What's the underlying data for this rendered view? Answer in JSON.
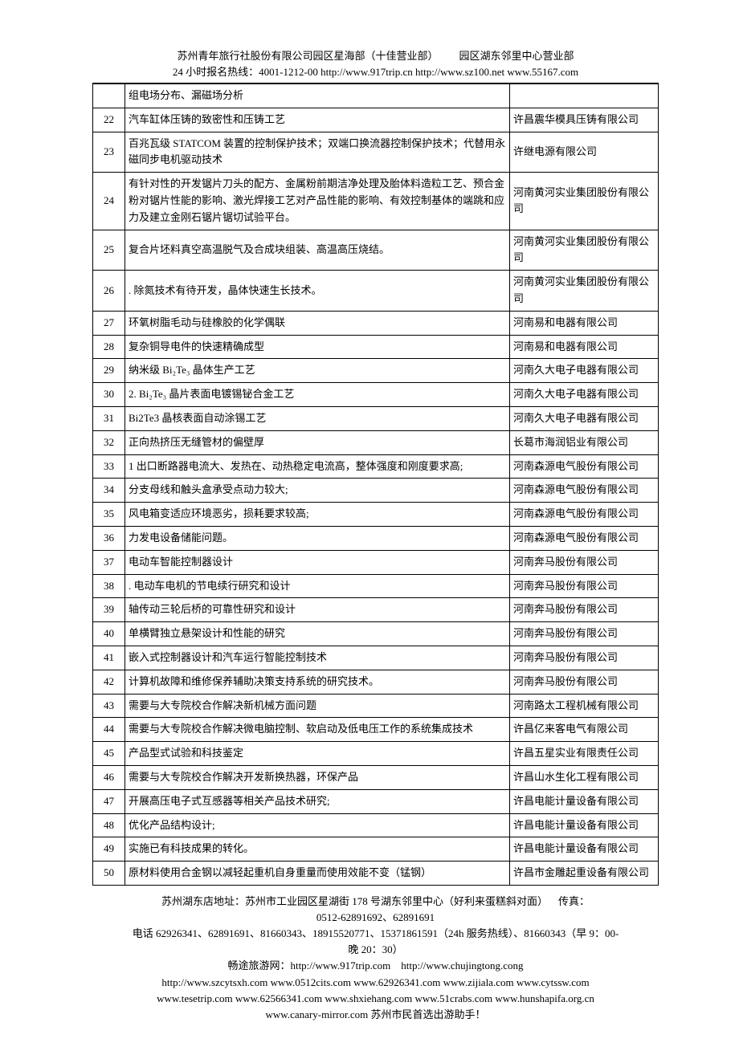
{
  "header": {
    "line1": "苏州青年旅行社股份有限公司园区星海部（十佳营业部）  园区湖东邻里中心营业部",
    "line2": "24 小时报名热线：4001-1212-00 http://www.917trip.cn http://www.sz100.net www.55167.com"
  },
  "rows": [
    {
      "n": "",
      "d": "组电场分布、漏磁场分析",
      "c": ""
    },
    {
      "n": "22",
      "d": "汽车缸体压铸的致密性和压铸工艺",
      "c": "许昌震华模具压铸有限公司"
    },
    {
      "n": "23",
      "d": "百兆瓦级 STATCOM 装置的控制保护技术；双端口换流器控制保护技术；代替用永磁同步电机驱动技术",
      "c": "许继电源有限公司"
    },
    {
      "n": "24",
      "d": "有针对性的开发锯片刀头的配方、金属粉前期洁净处理及胎体料造粒工艺、预合金粉对锯片性能的影响、激光焊接工艺对产品性能的影响、有效控制基体的端跳和应力及建立金刚石锯片锯切试验平台。",
      "c": "河南黄河实业集团股份有限公司"
    },
    {
      "n": "25",
      "d": "复合片坯料真空高温脱气及合成块组装、高温高压烧结。",
      "c": "河南黄河实业集团股份有限公司"
    },
    {
      "n": "26",
      "d": ". 除氮技术有待开发，晶体快速生长技术。",
      "c": "河南黄河实业集团股份有限公司"
    },
    {
      "n": "27",
      "d": "环氧树脂毛动与硅橡胶的化学偶联",
      "c": "河南易和电器有限公司"
    },
    {
      "n": "28",
      "d": "复杂铜导电件的快速精确成型",
      "c": "河南易和电器有限公司"
    },
    {
      "n": "29",
      "d": "纳米级 Bi₂Te₃ 晶体生产工艺",
      "c": "河南久大电子电器有限公司"
    },
    {
      "n": "30",
      "d": "2. Bi₂Te₃ 晶片表面电镀锡铋合金工艺",
      "c": "河南久大电子电器有限公司"
    },
    {
      "n": "31",
      "d": "Bi2Te3 晶核表面自动涂锡工艺",
      "c": "河南久大电子电器有限公司"
    },
    {
      "n": "32",
      "d": "正向热挤压无缝管材的偏壁厚",
      "c": "长葛市海润铝业有限公司"
    },
    {
      "n": "33",
      "d": "1 出口断路器电流大、发热在、动热稳定电流高，整体强度和刚度要求高;",
      "c": "河南森源电气股份有限公司"
    },
    {
      "n": "34",
      "d": "分支母线和触头盒承受点动力较大;",
      "c": "河南森源电气股份有限公司"
    },
    {
      "n": "35",
      "d": "风电箱变适应环境恶劣，损耗要求较高;",
      "c": "河南森源电气股份有限公司"
    },
    {
      "n": "36",
      "d": "力发电设备储能问题。",
      "c": "河南森源电气股份有限公司"
    },
    {
      "n": "37",
      "d": "电动车智能控制器设计",
      "c": "河南奔马股份有限公司"
    },
    {
      "n": "38",
      "d": ". 电动车电机的节电续行研究和设计",
      "c": "河南奔马股份有限公司"
    },
    {
      "n": "39",
      "d": "轴传动三轮后桥的可靠性研究和设计",
      "c": "河南奔马股份有限公司"
    },
    {
      "n": "40",
      "d": "单横臂独立悬架设计和性能的研究",
      "c": "河南奔马股份有限公司"
    },
    {
      "n": "41",
      "d": "嵌入式控制器设计和汽车运行智能控制技术",
      "c": "河南奔马股份有限公司"
    },
    {
      "n": "42",
      "d": "计算机故障和维修保养辅助决策支持系统的研究技术。",
      "c": "河南奔马股份有限公司"
    },
    {
      "n": "43",
      "d": "需要与大专院校合作解决新机械方面问题",
      "c": "河南路太工程机械有限公司"
    },
    {
      "n": "44",
      "d": "需要与大专院校合作解决微电脑控制、软启动及低电压工作的系统集成技术",
      "c": "许昌亿来客电气有限公司"
    },
    {
      "n": "45",
      "d": "产品型式试验和科技鉴定",
      "c": "许昌五星实业有限责任公司"
    },
    {
      "n": "46",
      "d": "需要与大专院校合作解决开发新换热器，环保产品",
      "c": "许昌山水生化工程有限公司"
    },
    {
      "n": "47",
      "d": "开展高压电子式互感器等相关产品技术研究;",
      "c": "许昌电能计量设备有限公司"
    },
    {
      "n": "48",
      "d": "优化产品结构设计;",
      "c": "许昌电能计量设备有限公司"
    },
    {
      "n": "49",
      "d": "实施已有科技成果的转化。",
      "c": "许昌电能计量设备有限公司"
    },
    {
      "n": "50",
      "d": "原材料使用合金钢以减轻起重机自身重量而使用效能不变（锰钢）",
      "c": "许昌市金雕起重设备有限公司"
    }
  ],
  "footer": {
    "l1": "苏州湖东店地址：苏州市工业园区星湖街 178 号湖东邻里中心（好利来蛋糕斜对面） 传真：",
    "l2": "0512-62891692、62891691",
    "l3": "电话 62926341、62891691、81660343、18915520771、15371861591（24h 服务热线）、81660343（早 9：00-",
    "l4": "晚 20：30）",
    "l5": "畅途旅游网：http://www.917trip.com http://www.chujingtong.cong",
    "l6": "http://www.szcytsxh.com www.0512cits.com www.62926341.com www.zijiala.com www.cytssw.com",
    "l7": "www.tesetrip.com www.62566341.com www.shxiehang.com www.51crabs.com www.hunshapifa.org.cn",
    "l8": "www.canary-mirror.com 苏州市民首选出游助手！"
  }
}
